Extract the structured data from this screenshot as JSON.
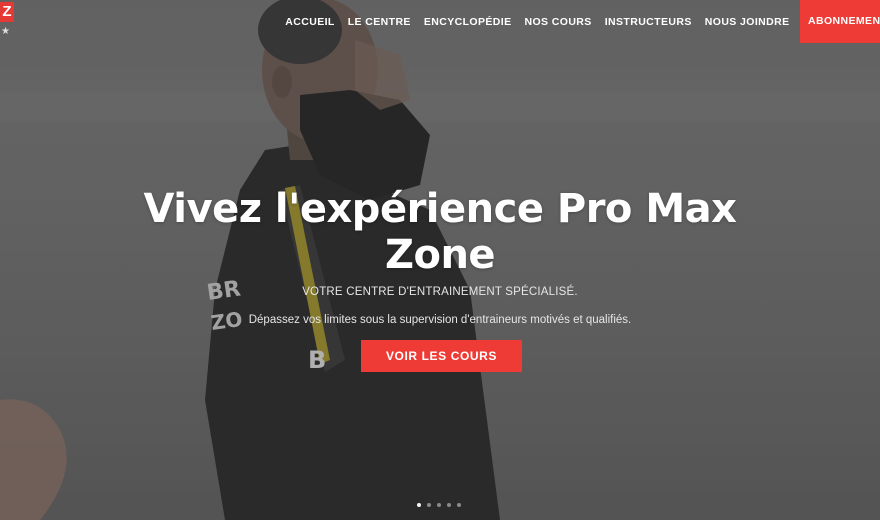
{
  "brand": {
    "logo_letter": "Z"
  },
  "nav": {
    "items": [
      "ACCUEIL",
      "LE CENTRE",
      "ENCYCLOPÉDIE",
      "NOS COURS",
      "INSTRUCTEURS",
      "NOUS JOINDRE"
    ],
    "cta": "ABONNEMENT"
  },
  "hero": {
    "title": "Vivez l'expérience Pro Max Zone",
    "subtitle": "VOTRE CENTRE D'ENTRAINEMENT SPÉCIALISÉ.",
    "description": "Dépassez vos limites sous la supervision d'entraineurs motivés et qualifiés.",
    "button": "VOIR LES COURS"
  },
  "slider": {
    "count": 5,
    "active_index": 0
  },
  "colors": {
    "accent": "#ef3b36",
    "text": "#ffffff"
  }
}
